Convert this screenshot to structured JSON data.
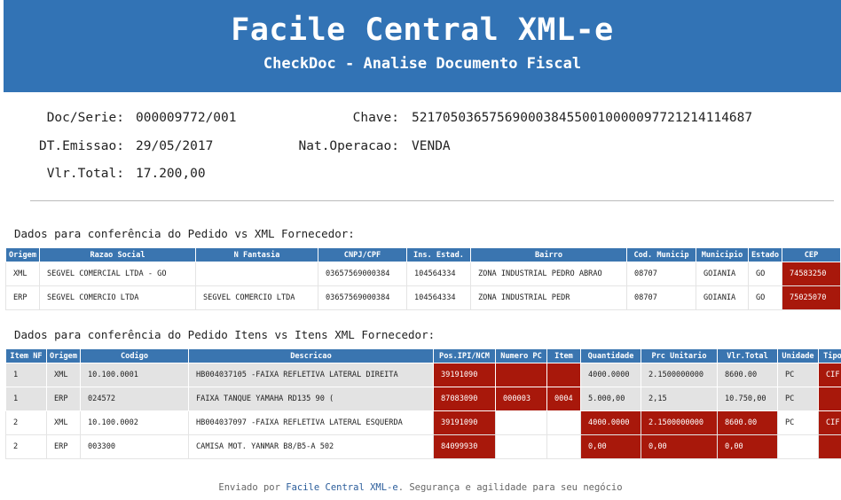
{
  "header": {
    "title": "Facile Central XML-e",
    "subtitle": "CheckDoc - Analise Documento Fiscal"
  },
  "doc": {
    "doc_serie_label": "Doc/Serie:",
    "doc_serie": "000009772/001",
    "chave_label": "Chave:",
    "chave": "52170503657569000384550010000097721214114687",
    "dt_emissao_label": "DT.Emissao:",
    "dt_emissao": "29/05/2017",
    "nat_operacao_label": "Nat.Operacao:",
    "nat_operacao": "VENDA",
    "vlr_total_label": "Vlr.Total:",
    "vlr_total": "17.200,00"
  },
  "pedido": {
    "section_title": "Dados para conferência do Pedido vs XML Fornecedor:",
    "columns": [
      "Origem",
      "Razao Social",
      "N Fantasia",
      "CNPJ/CPF",
      "Ins. Estad.",
      "Bairro",
      "Cod. Municip",
      "Municipio",
      "Estado",
      "CEP"
    ],
    "rows": [
      {
        "cells": [
          "XML",
          "SEGVEL COMERCIAL LTDA - GO",
          "",
          "03657569000384",
          "104564334",
          "ZONA INDUSTRIAL PEDRO ABRAO",
          "08707",
          "GOIANIA",
          "GO",
          "74583250"
        ]
      },
      {
        "cells": [
          "ERP",
          "SEGVEL COMERCIO LTDA",
          "SEGVEL COMERCIO LTDA",
          "03657569000384",
          "104564334",
          "ZONA INDUSTRIAL PEDR",
          "08707",
          "GOIANIA",
          "GO",
          "75025070"
        ]
      }
    ]
  },
  "itens": {
    "section_title": "Dados para conferência do Pedido Itens vs Itens XML Fornecedor:",
    "columns": [
      "Item NF",
      "Origem",
      "Codigo",
      "Descricao",
      "Pos.IPI/NCM",
      "Numero PC",
      "Item",
      "Quantidade",
      "Prc Unitario",
      "Vlr.Total",
      "Unidade",
      "Tipo Frete"
    ],
    "rows": [
      {
        "cells": [
          "1",
          "XML",
          "10.100.0001",
          "HB004037105 -FAIXA REFLETIVA LATERAL DIREITA",
          "39191090",
          "",
          "",
          "4000.0000",
          "2.1500000000",
          "8600.00",
          "PC",
          "CIF"
        ]
      },
      {
        "cells": [
          "1",
          "ERP",
          "024572",
          "FAIXA TANQUE YAMAHA RD135 90 (",
          "87083090",
          "000003",
          "0004",
          "5.000,00",
          "2,15",
          "10.750,00",
          "PC",
          ""
        ]
      },
      {
        "cells": [
          "2",
          "XML",
          "10.100.0002",
          "HB004037097 -FAIXA REFLETIVA LATERAL ESQUERDA",
          "39191090",
          "",
          "",
          "4000.0000",
          "2.1500000000",
          "8600.00",
          "PC",
          "CIF"
        ]
      },
      {
        "cells": [
          "2",
          "ERP",
          "003300",
          "CAMISA MOT. YANMAR B8/B5-A 502",
          "84099930",
          "",
          "",
          "0,00",
          "0,00",
          "0,00",
          "",
          ""
        ]
      }
    ]
  },
  "footer": {
    "prefix": "Enviado por ",
    "brand": "Facile Central XML-e",
    "suffix": ". Segurança e agilidade para seu negócio"
  },
  "colors": {
    "header_bg": "#3273b5",
    "table_header_bg": "#3a75b0",
    "mismatch_red": "#a8180b",
    "row_alt_bg": "#e3e3e3"
  }
}
